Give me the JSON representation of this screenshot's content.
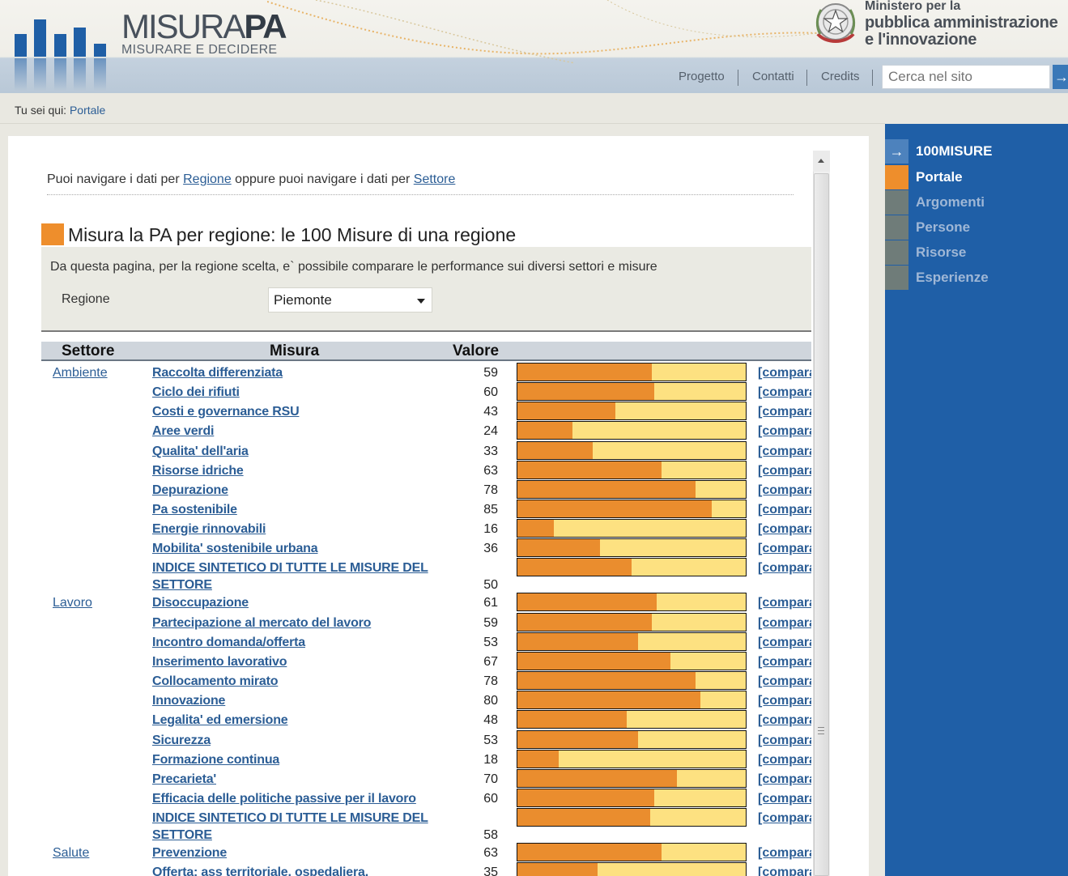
{
  "header": {
    "logo_main": "MISURA",
    "logo_bold": "PA",
    "logo_sub": "MISURARE E DECIDERE",
    "ministry_line1": "Ministero per la",
    "ministry_line2": "pubblica amministrazione",
    "ministry_line3": "e l'innovazione",
    "nav": [
      "Progetto",
      "Contatti",
      "Credits"
    ],
    "search_placeholder": "Cerca nel sito",
    "search_go_icon": "arrow-right-icon"
  },
  "breadcrumb": {
    "label": "Tu sei qui:",
    "link": "Portale"
  },
  "sidebar": {
    "items": [
      {
        "label": "100MISURE",
        "icon": "arrow-right-icon",
        "state": "header"
      },
      {
        "label": "Portale",
        "state": "active"
      },
      {
        "label": "Argomenti",
        "state": "inactive"
      },
      {
        "label": "Persone",
        "state": "inactive"
      },
      {
        "label": "Risorse",
        "state": "inactive"
      },
      {
        "label": "Esperienze",
        "state": "inactive"
      }
    ]
  },
  "main": {
    "intro": {
      "text1": "Puoi navigare i dati per ",
      "link1": "Regione",
      "text2": " oppure puoi navigare i dati per ",
      "link2": "Settore"
    },
    "title": "Misura la PA per regione: le 100 Misure di una regione",
    "description": "Da questa pagina, per la regione scelta, e` possibile comparare le performance sui diversi settori e misure",
    "region_label": "Regione",
    "region_value": "Piemonte",
    "table": {
      "headers": [
        "Settore",
        "Misura",
        "Valore"
      ],
      "compare_label": "[comparare]",
      "rows": [
        {
          "settore": "Ambiente",
          "misura": "Raccolta differenziata",
          "valore": 59
        },
        {
          "settore": "",
          "misura": "Ciclo dei rifiuti",
          "valore": 60
        },
        {
          "settore": "",
          "misura": "Costi e governance RSU",
          "valore": 43
        },
        {
          "settore": "",
          "misura": "Aree verdi",
          "valore": 24
        },
        {
          "settore": "",
          "misura": "Qualita' dell'aria",
          "valore": 33
        },
        {
          "settore": "",
          "misura": "Risorse idriche",
          "valore": 63
        },
        {
          "settore": "",
          "misura": "Depurazione",
          "valore": 78
        },
        {
          "settore": "",
          "misura": "Pa sostenibile",
          "valore": 85
        },
        {
          "settore": "",
          "misura": "Energie rinnovabili",
          "valore": 16
        },
        {
          "settore": "",
          "misura": "Mobilita' sostenibile urbana",
          "valore": 36
        },
        {
          "settore": "",
          "misura": "INDICE SINTETICO DI TUTTE LE MISURE DEL SETTORE",
          "valore": 50,
          "two_line": true
        },
        {
          "settore": "Lavoro",
          "misura": "Disoccupazione",
          "valore": 61
        },
        {
          "settore": "",
          "misura": "Partecipazione al mercato del lavoro",
          "valore": 59
        },
        {
          "settore": "",
          "misura": "Incontro domanda/offerta",
          "valore": 53
        },
        {
          "settore": "",
          "misura": "Inserimento lavorativo",
          "valore": 67
        },
        {
          "settore": "",
          "misura": "Collocamento mirato",
          "valore": 78
        },
        {
          "settore": "",
          "misura": "Innovazione",
          "valore": 80
        },
        {
          "settore": "",
          "misura": "Legalita' ed emersione",
          "valore": 48
        },
        {
          "settore": "",
          "misura": "Sicurezza",
          "valore": 53
        },
        {
          "settore": "",
          "misura": "Formazione continua",
          "valore": 18
        },
        {
          "settore": "",
          "misura": "Precarieta'",
          "valore": 70
        },
        {
          "settore": "",
          "misura": "Efficacia delle politiche passive per il lavoro",
          "valore": 60
        },
        {
          "settore": "",
          "misura": "INDICE SINTETICO DI TUTTE LE MISURE DEL SETTORE",
          "valore": 58,
          "two_line": true
        },
        {
          "settore": "Salute",
          "misura": "Prevenzione",
          "valore": 63
        },
        {
          "settore": "",
          "misura": "Offerta: ass territoriale, ospedaliera,",
          "valore": 35,
          "partial": true
        }
      ]
    }
  },
  "colors": {
    "bar_fill": "#ea8d2e",
    "bar_bg": "#fde181",
    "sidebar": "#1f5fa7",
    "accent": "#ee8e2c"
  }
}
